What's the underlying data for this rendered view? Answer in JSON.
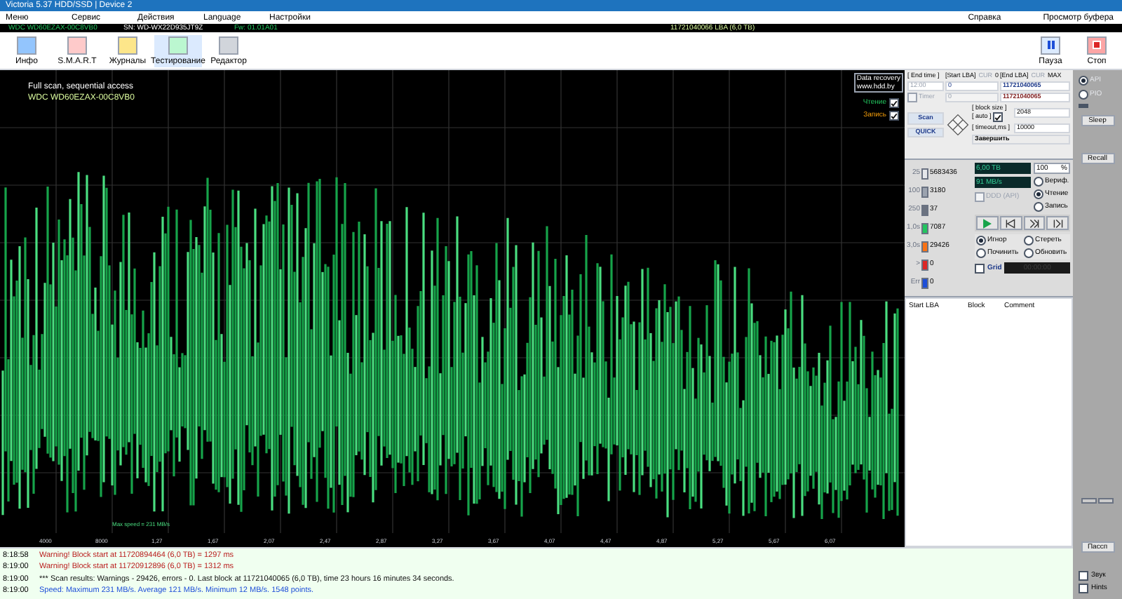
{
  "window": {
    "title": "Victoria 5.37 HDD/SSD | Device 2"
  },
  "menu": {
    "left": [
      "Меню",
      "Сервис",
      "Действия",
      "Language",
      "Настройки"
    ],
    "right": [
      "Справка",
      "Просмотр буфера"
    ]
  },
  "drive_bar": {
    "model": "WDC WD60EZAX-00C8VB0",
    "serial": "SN: WD-WX22D935JT9Z",
    "firmware": "Fw: 01.01A01",
    "capacity": "11721040066 LBA (6,0 TB)"
  },
  "toolbar": [
    {
      "label": "Инфо",
      "selected": false
    },
    {
      "label": "S.M.A.R.T",
      "selected": false
    },
    {
      "label": "Журналы",
      "selected": false
    },
    {
      "label": "Тестирование",
      "selected": true
    },
    {
      "label": "Редактор",
      "selected": false
    }
  ],
  "toolbar_right": [
    {
      "kind": "pause",
      "label": "Пауза"
    },
    {
      "kind": "stop",
      "label": "Стоп"
    }
  ],
  "graph": {
    "title": "Full scan, sequential access",
    "subtitle": "WDC WD60EZAX-00C8VB0",
    "max_note": "Max speed = 231 MB/s",
    "xticks": [
      "4000",
      "8000",
      "1,27",
      "1,67",
      "2,07",
      "2,47",
      "2,87",
      "3,27",
      "3,67",
      "4,07",
      "4,47",
      "4,87",
      "5,27",
      "5,67",
      "6,07"
    ],
    "badge": [
      "Data recovery",
      "www.hdd.by"
    ],
    "checks": [
      {
        "label": "Чтение",
        "checked": true,
        "color": "#22c55e"
      },
      {
        "label": "Запись",
        "checked": true,
        "color": "#f59e0b"
      }
    ]
  },
  "controls": {
    "end_time_label": "[ End time ]",
    "end_time": "12:00",
    "timer_label": "Timer",
    "timer_checked": false,
    "timer_value": "0",
    "start_lba_label": "[Start LBA]",
    "cur": "CUR",
    "cur_2": "CUR",
    "zero": "0",
    "start_lba": "0",
    "end_lba_label": "[End LBA]",
    "max": "MAX",
    "end_lba": "11721040065",
    "end_lba_2": "11721040065",
    "scan": "Scan",
    "quick": "QUICK",
    "block_size_label": "[ block size ]",
    "auto_label": "[ auto ]",
    "auto_checked": true,
    "block_size": "2048",
    "timeout_label": "[ timeout,ms ]",
    "timeout": "10000",
    "finish": "Завершить"
  },
  "stats": [
    {
      "label": "25",
      "count": "5683436",
      "color": "#e5e7eb"
    },
    {
      "label": "100",
      "count": "3180",
      "color": "#9ca3af"
    },
    {
      "label": "250",
      "count": "37",
      "color": "#6b7280"
    },
    {
      "label": "1,0s",
      "count": "7087",
      "color": "#22c55e"
    },
    {
      "label": "3,0s",
      "count": "29426",
      "color": "#f97316"
    },
    {
      "label": ">",
      "count": "0",
      "color": "#dc2626"
    },
    {
      "label": "Err",
      "count": "0",
      "color": "#1d4ed8"
    }
  ],
  "readouts": {
    "size": "6,00 TB",
    "percent": "100",
    "percent_unit": "%",
    "speed": "91 MB/s",
    "ddd": "DDD (API)",
    "ddd_checked": false
  },
  "mode": [
    {
      "label": "Вериф.",
      "selected": false
    },
    {
      "label": "Чтение",
      "selected": true
    },
    {
      "label": "Запись",
      "selected": false
    }
  ],
  "action": [
    {
      "label": "Игнор",
      "selected": true
    },
    {
      "label": "Стереть",
      "selected": false
    },
    {
      "label": "Починить",
      "selected": false
    },
    {
      "label": "Обновить",
      "selected": false
    }
  ],
  "grid": {
    "label": "Grid",
    "checked": false,
    "time": "00:00:00"
  },
  "table": {
    "columns": [
      "Start LBA",
      "Block",
      "Comment"
    ]
  },
  "side": {
    "api": [
      {
        "label": "API",
        "selected": true
      },
      {
        "label": "PIO",
        "selected": false
      }
    ],
    "sleep": "Sleep",
    "recall": "Recall",
    "passport": "Пассп"
  },
  "log": [
    {
      "time": "8:18:58",
      "text": "Warning! Block start at 11720894464 (6,0 TB)  = 1297 ms",
      "kind": "warning"
    },
    {
      "time": "8:19:00",
      "text": "Warning! Block start at 11720912896 (6,0 TB)  = 1312 ms",
      "kind": "warning"
    },
    {
      "time": "8:19:00",
      "text": "*** Scan results: Warnings - 29426, errors - 0. Last block at 11721040065 (6,0 TB), time 23 hours 16 minutes 34 seconds.",
      "kind": "info"
    },
    {
      "time": "8:19:00",
      "text": "Speed: Maximum 231 MB/s. Average 121 MB/s. Minimum 12 MB/s. 1548 points.",
      "kind": "speed"
    }
  ],
  "log_options": [
    {
      "label": "Звук",
      "checked": false
    },
    {
      "label": "Hints",
      "checked": false
    }
  ]
}
